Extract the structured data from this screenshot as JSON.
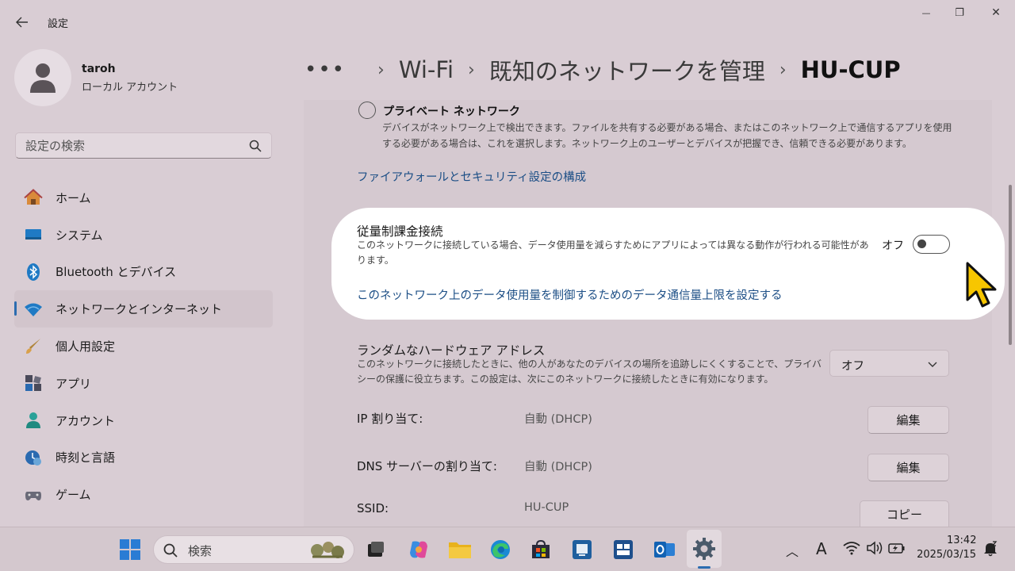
{
  "window": {
    "title": "設定",
    "minimize_glyph": "—",
    "maximize_glyph": "❐",
    "close_glyph": "✕"
  },
  "profile": {
    "name": "taroh",
    "account_type": "ローカル アカウント"
  },
  "search": {
    "placeholder": "設定の検索"
  },
  "sidebar": {
    "items": [
      {
        "label": "ホーム",
        "icon": "home-icon"
      },
      {
        "label": "システム",
        "icon": "system-icon"
      },
      {
        "label": "Bluetooth とデバイス",
        "icon": "bluetooth-icon"
      },
      {
        "label": "ネットワークとインターネット",
        "icon": "wifi-icon",
        "active": true
      },
      {
        "label": "個人用設定",
        "icon": "brush-icon"
      },
      {
        "label": "アプリ",
        "icon": "apps-icon"
      },
      {
        "label": "アカウント",
        "icon": "account-icon"
      },
      {
        "label": "時刻と言語",
        "icon": "time-language-icon"
      },
      {
        "label": "ゲーム",
        "icon": "gamepad-icon"
      }
    ]
  },
  "breadcrumb": {
    "overflow": "•••",
    "sep": "›",
    "items": [
      "Wi-Fi",
      "既知のネットワークを管理"
    ],
    "current": "HU-CUP"
  },
  "network_profile": {
    "private_label": "プライベート ネットワーク",
    "private_desc": "デバイスがネットワーク上で検出できます。ファイルを共有する必要がある場合、またはこのネットワーク上で通信するアプリを使用する必要がある場合は、これを選択します。ネットワーク上のユーザーとデバイスが把握でき、信頼できる必要があります。",
    "firewall_link": "ファイアウォールとセキュリティ設定の構成"
  },
  "metered": {
    "title": "従量制課金接続",
    "desc": "このネットワークに接続している場合、データ使用量を減らすためにアプリによっては異なる動作が行われる可能性があります。",
    "toggle_label": "オフ",
    "toggle_on": false,
    "limit_link": "このネットワーク上のデータ使用量を制御するためのデータ通信量上限を設定する"
  },
  "random_hw": {
    "title": "ランダムなハードウェア アドレス",
    "desc": "このネットワークに接続したときに、他の人があなたのデバイスの場所を追跡しにくくすることで、プライバシーの保護に役立ちます。この設定は、次にこのネットワークに接続したときに有効になります。",
    "selected": "オフ"
  },
  "properties": {
    "ip_label": "IP 割り当て:",
    "ip_value": "自動 (DHCP)",
    "dns_label": "DNS サーバーの割り当て:",
    "dns_value": "自動 (DHCP)",
    "ssid_label": "SSID:",
    "ssid_value": "HU-CUP",
    "edit_label": "編集",
    "copy_label": "コピー"
  },
  "taskbar": {
    "search_label": "検索",
    "time": "13:42",
    "date": "2025/03/15",
    "ime_indicator": "A",
    "tray_chevron": "︿"
  },
  "colors": {
    "accent": "#2b6cb0",
    "link": "#1d4f86",
    "dim_overlay": "#d9cdd4",
    "cursor_fill": "#f7c600"
  }
}
